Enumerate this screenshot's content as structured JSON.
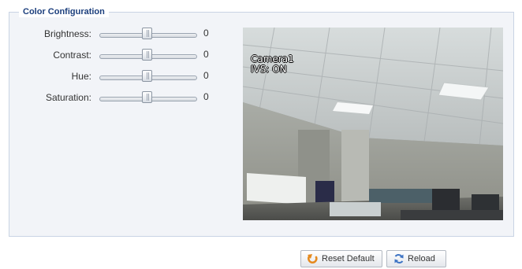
{
  "section": {
    "title": "Color Configuration"
  },
  "controls": [
    {
      "label": "Brightness:",
      "value": "0"
    },
    {
      "label": "Contrast:",
      "value": "0"
    },
    {
      "label": "Hue:",
      "value": "0"
    },
    {
      "label": "Saturation:",
      "value": "0"
    }
  ],
  "preview": {
    "camera_label": "Camera1",
    "ivs_status": "IVS: ON"
  },
  "buttons": {
    "reset_default": "Reset Default",
    "reload": "Reload"
  },
  "colors": {
    "legend_text": "#1c3f7d",
    "panel_bg": "#f2f4f8",
    "panel_border": "#c9d4e4"
  },
  "icons": {
    "reset": "undo-arrow-icon",
    "reload": "refresh-icon"
  }
}
